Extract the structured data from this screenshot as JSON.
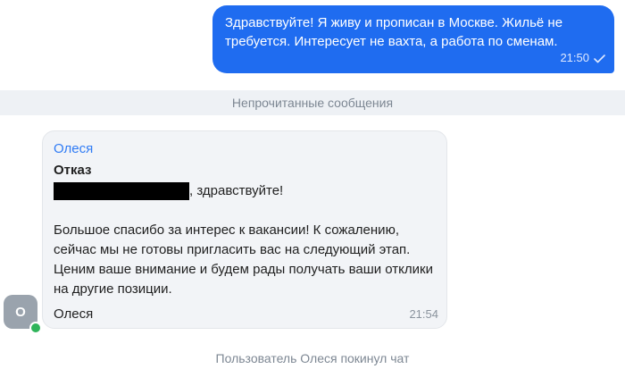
{
  "outgoing_message": {
    "text": "Здравствуйте! Я живу и прописан в Москве. Жильё не требуется. Интересует не вахта, а работа по сменам.",
    "time": "21:50",
    "status_icon": "single-check-icon"
  },
  "unread_divider": {
    "label": "Непрочитанные сообщения"
  },
  "incoming_message": {
    "sender": "Олеся",
    "subject": "Отказ",
    "greeting_suffix": ", здравствуйте!",
    "body": "Большое спасибо за интерес к вакансии! К сожалению, сейчас мы не готовы пригласить вас на следующий этап. Ценим ваше внимание и будем рады получать ваши отклики на другие позиции.",
    "signature": "Олеся",
    "time": "21:54"
  },
  "avatar": {
    "initial": "О",
    "online": true
  },
  "system_message": {
    "text": "Пользователь Олеся покинул чат"
  },
  "colors": {
    "outgoing_bubble": "#1f6cf0",
    "incoming_bubble": "#f2f4f7",
    "sender_name": "#2f7bf5",
    "online_indicator": "#2fb45a"
  }
}
